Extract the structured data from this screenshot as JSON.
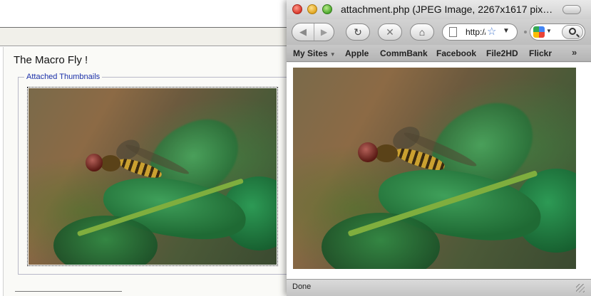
{
  "forum": {
    "post_title": "The Macro Fly !",
    "attachments_legend": "Attached Thumbnails"
  },
  "window": {
    "title": "attachment.php (JPEG Image, 2267x1617 pix…"
  },
  "toolbar": {
    "back_icon": "◀",
    "forward_icon": "▶",
    "reload_icon": "↻",
    "stop_icon": "✕",
    "home_icon": "⌂",
    "url_value": "http://",
    "star_icon": "☆",
    "dropdown_icon": "▼"
  },
  "bookmarks": {
    "items": [
      "My Sites",
      "Apple",
      "CommBank",
      "Facebook",
      "File2HD",
      "Flickr"
    ],
    "more_icon": "»"
  },
  "status": {
    "text": "Done"
  }
}
